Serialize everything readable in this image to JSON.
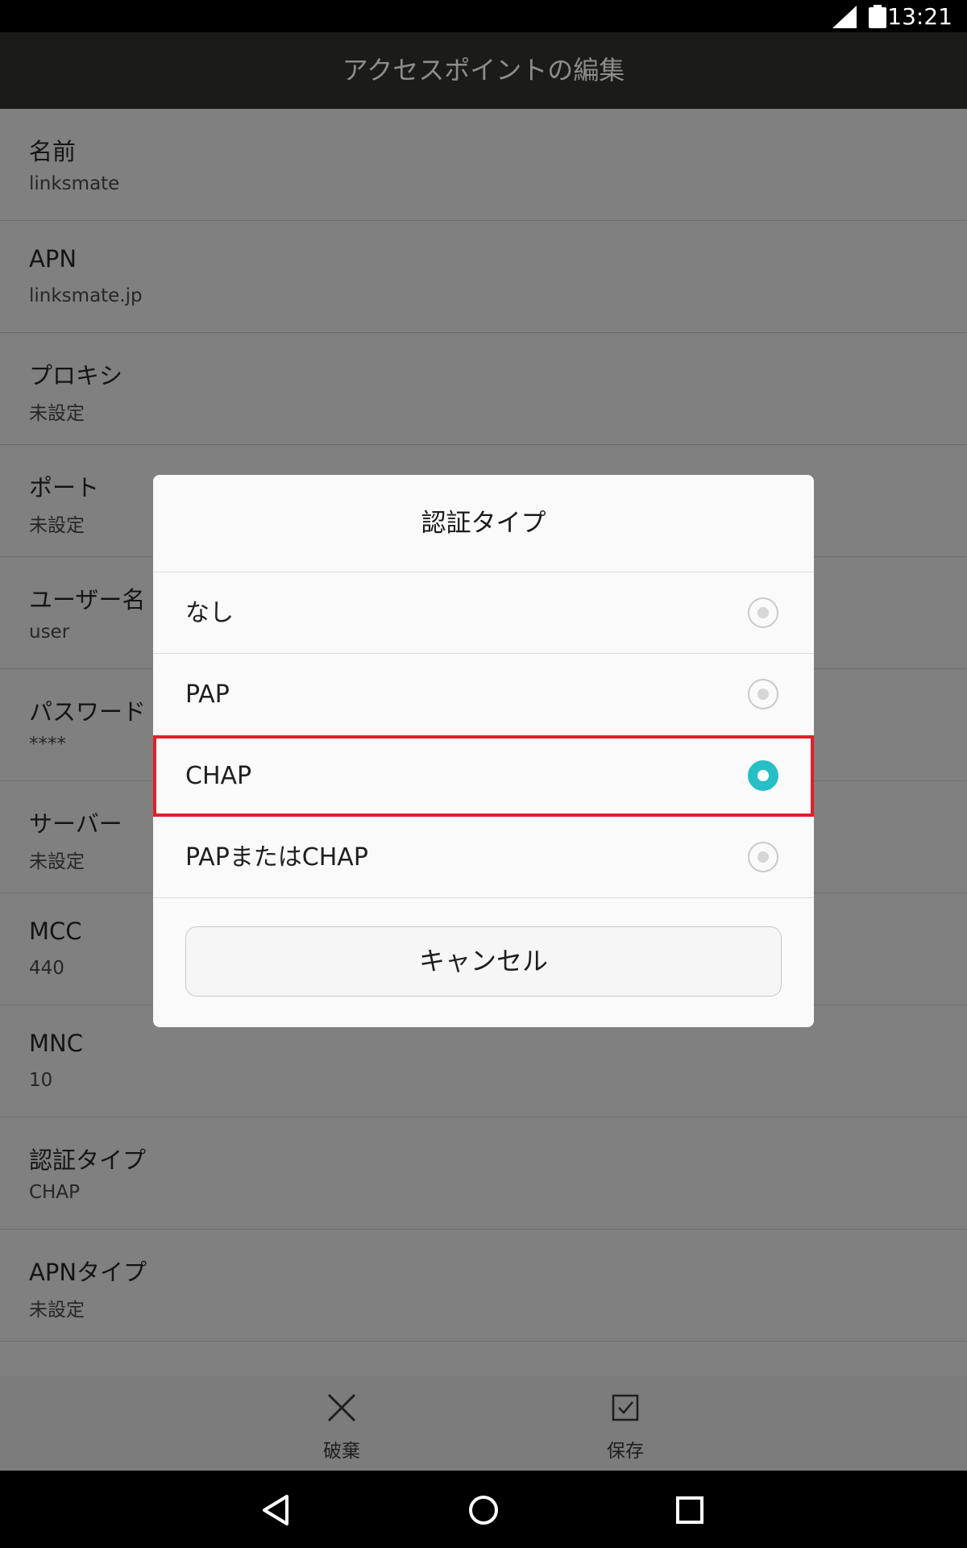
{
  "status_bar": {
    "time": "13:21"
  },
  "app_bar": {
    "title": "アクセスポイントの編集"
  },
  "settings": [
    {
      "label": "名前",
      "value": "linksmate"
    },
    {
      "label": "APN",
      "value": "linksmate.jp"
    },
    {
      "label": "プロキシ",
      "value": "未設定"
    },
    {
      "label": "ポート",
      "value": "未設定"
    },
    {
      "label": "ユーザー名",
      "value": "user"
    },
    {
      "label": "パスワード",
      "value": "****"
    },
    {
      "label": "サーバー",
      "value": "未設定"
    },
    {
      "label": "MCC",
      "value": "440"
    },
    {
      "label": "MNC",
      "value": "10"
    },
    {
      "label": "認証タイプ",
      "value": "CHAP"
    },
    {
      "label": "APNタイプ",
      "value": "未設定"
    }
  ],
  "dialog": {
    "title": "認証タイプ",
    "options": [
      {
        "label": "なし",
        "selected": false
      },
      {
        "label": "PAP",
        "selected": false
      },
      {
        "label": "CHAP",
        "selected": true
      },
      {
        "label": "PAPまたはCHAP",
        "selected": false
      }
    ],
    "cancel_label": "キャンセル"
  },
  "actions": {
    "discard_label": "破棄",
    "save_label": "保存"
  },
  "colors": {
    "accent": "#27bfc6",
    "highlight": "#e0202a"
  }
}
